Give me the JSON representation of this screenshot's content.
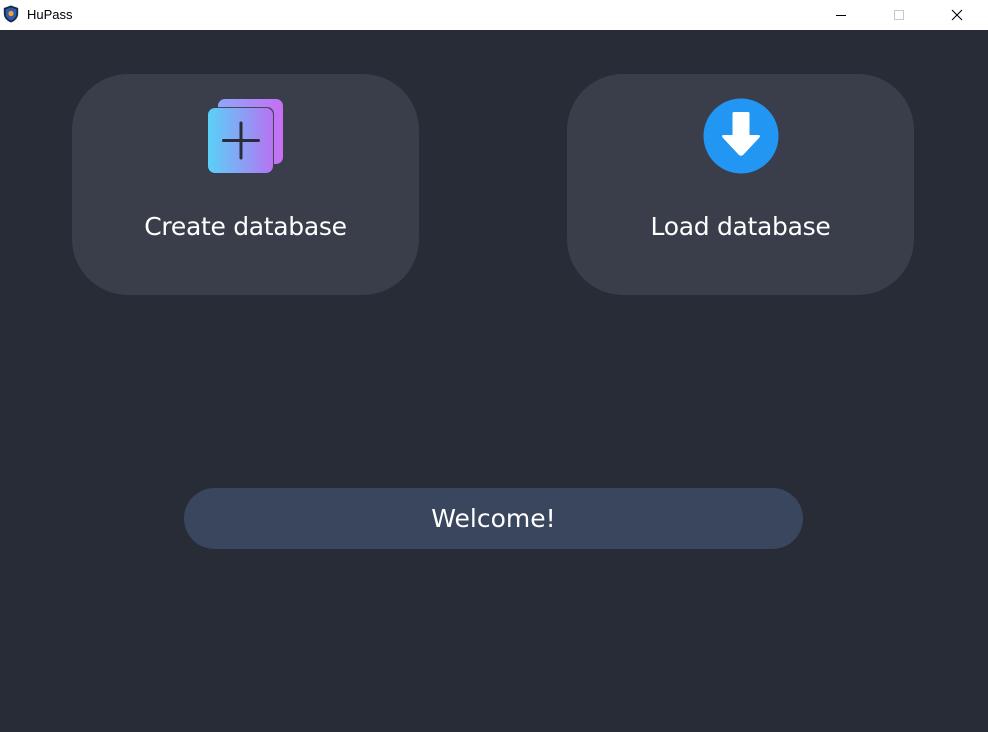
{
  "window": {
    "title": "HuPass",
    "controls": {
      "minimize": "minimize-icon",
      "maximize": "maximize-icon",
      "close": "close-icon"
    }
  },
  "actions": {
    "create": {
      "label": "Create database",
      "icon": "add-stack-icon"
    },
    "load": {
      "label": "Load database",
      "icon": "download-arrow-icon"
    }
  },
  "status": {
    "message": "Welcome!"
  },
  "colors": {
    "background": "#282c36",
    "card": "#3a3e4b",
    "status_bar": "#3a465d",
    "load_icon": "#2196f3",
    "create_icon_gradient_start": "#5ad1f7",
    "create_icon_gradient_end": "#c66ff2"
  }
}
